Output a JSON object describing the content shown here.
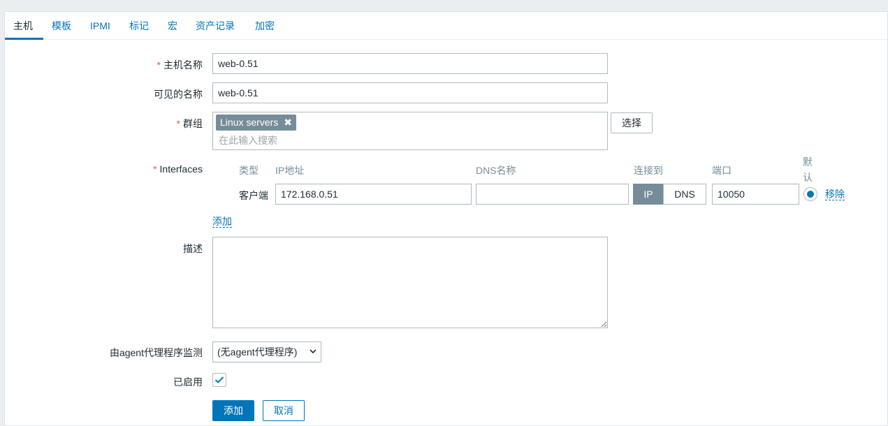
{
  "tabs": [
    {
      "label": "主机",
      "active": true
    },
    {
      "label": "模板"
    },
    {
      "label": "IPMI"
    },
    {
      "label": "标记"
    },
    {
      "label": "宏"
    },
    {
      "label": "资产记录"
    },
    {
      "label": "加密"
    }
  ],
  "form": {
    "host_name": {
      "label": "主机名称",
      "value": "web-0.51",
      "required_mark": "*"
    },
    "visible_name": {
      "label": "可见的名称",
      "value": "web-0.51"
    },
    "groups": {
      "label": "群组",
      "required_mark": "*",
      "tags": [
        "Linux servers"
      ],
      "placeholder": "在此输入搜索",
      "select_button": "选择"
    },
    "interfaces": {
      "label": "Interfaces",
      "required_mark": "*",
      "headers": {
        "type": "类型",
        "ip": "IP地址",
        "dns": "DNS名称",
        "connect_to": "连接到",
        "port": "端口",
        "default_line1": "默",
        "default_line2": "认"
      },
      "rows": [
        {
          "type": "客户端",
          "ip": "172.168.0.51",
          "dns": "",
          "connect_ip": "IP",
          "connect_dns": "DNS",
          "connect_selected": "IP",
          "port": "10050",
          "default": true,
          "remove": "移除"
        }
      ],
      "add_link": "添加"
    },
    "description": {
      "label": "描述",
      "value": ""
    },
    "proxy": {
      "label": "由agent代理程序监测",
      "selected": "(无agent代理程序)"
    },
    "enabled": {
      "label": "已启用",
      "checked": true
    },
    "buttons": {
      "add": "添加",
      "cancel": "取消"
    }
  },
  "colors": {
    "accent": "#0275b8",
    "required": "#e45959",
    "tag_bg": "#768d99"
  }
}
